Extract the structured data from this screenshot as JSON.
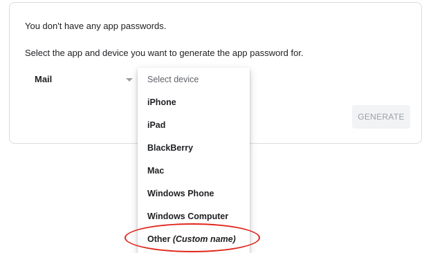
{
  "card": {
    "no_passwords_text": "You don't have any app passwords.",
    "instructions_text": "Select the app and device you want to generate the app password for.",
    "app_select": {
      "selected": "Mail"
    },
    "generate_button_label": "GENERATE"
  },
  "device_dropdown": {
    "placeholder": "Select device",
    "options": [
      "iPhone",
      "iPad",
      "BlackBerry",
      "Mac",
      "Windows Phone",
      "Windows Computer"
    ],
    "other_option": {
      "label": "Other",
      "hint": "(Custom name)"
    }
  },
  "colors": {
    "highlight_ring": "#e0271d",
    "disabled_button_text": "#9aa0a6",
    "disabled_button_bg": "#f1f3f4"
  }
}
